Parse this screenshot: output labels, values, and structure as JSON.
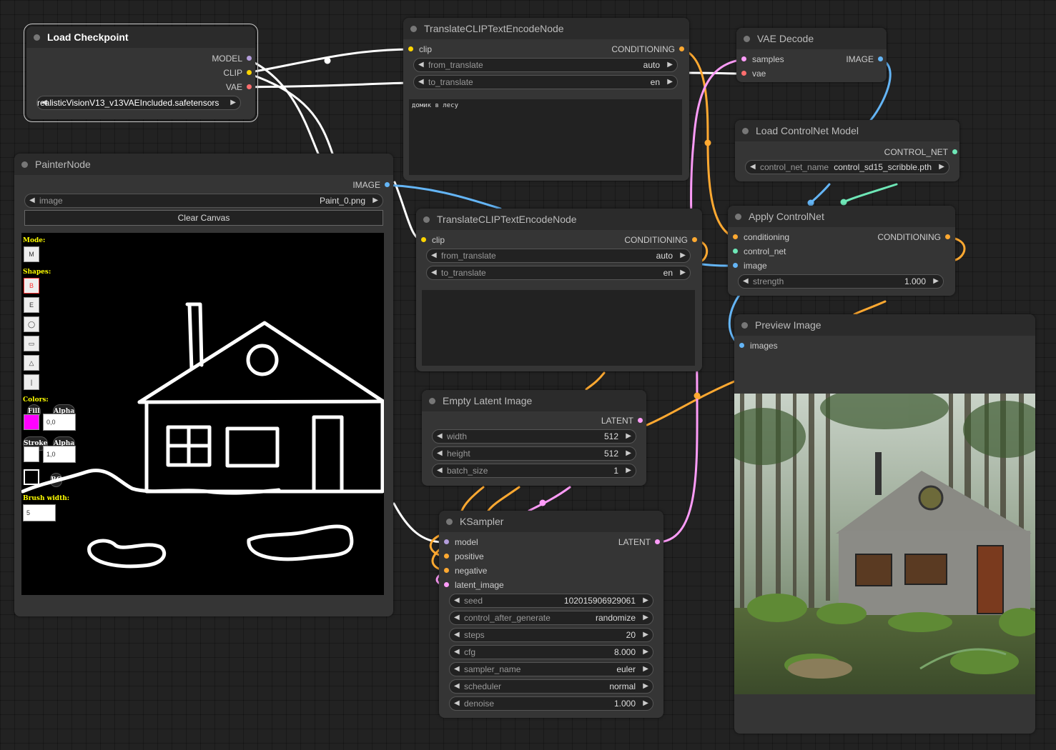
{
  "nodes": {
    "load_checkpoint": {
      "title": "Load Checkpoint",
      "outputs": [
        "MODEL",
        "CLIP",
        "VAE"
      ],
      "ckpt_name": "realisticVisionV13_v13VAEIncluded.safetensors"
    },
    "translate1": {
      "title": "TranslateCLIPTextEncodeNode",
      "input": "clip",
      "output": "CONDITIONING",
      "from_translate": {
        "name": "from_translate",
        "value": "auto"
      },
      "to_translate": {
        "name": "to_translate",
        "value": "en"
      },
      "text": "домик в лесу"
    },
    "translate2": {
      "title": "TranslateCLIPTextEncodeNode",
      "input": "clip",
      "output": "CONDITIONING",
      "from_translate": {
        "name": "from_translate",
        "value": "auto"
      },
      "to_translate": {
        "name": "to_translate",
        "value": "en"
      },
      "text": ""
    },
    "vae_decode": {
      "title": "VAE Decode",
      "inputs": [
        "samples",
        "vae"
      ],
      "output": "IMAGE"
    },
    "load_controlnet": {
      "title": "Load ControlNet Model",
      "output": "CONTROL_NET",
      "control_net_name": {
        "name": "control_net_name",
        "value": "control_sd15_scribble.pth"
      }
    },
    "apply_controlnet": {
      "title": "Apply ControlNet",
      "inputs": [
        "conditioning",
        "control_net",
        "image"
      ],
      "output": "CONDITIONING",
      "strength": {
        "name": "strength",
        "value": "1.000"
      }
    },
    "painter": {
      "title": "PainterNode",
      "output": "IMAGE",
      "image": {
        "name": "image",
        "value": "Paint_0.png"
      },
      "clear_button": "Clear Canvas",
      "toolbar": {
        "mode_label": "Mode:",
        "mode_btn": "M",
        "shapes_label": "Shapes:",
        "shape_buttons": [
          "B",
          "E",
          "◯",
          "▭",
          "△",
          "|"
        ],
        "colors_label": "Colors:",
        "fill_label": "Fill",
        "alpha_label": "Alpha",
        "fill_color": "#ff00ff",
        "fill_alpha": "0,0",
        "stroke_label": "Stroke",
        "stroke_color": "#ffffff",
        "stroke_alpha": "1,0",
        "bg_label": "BG",
        "brush_label": "Brush width:",
        "brush_width": "5"
      }
    },
    "empty_latent": {
      "title": "Empty Latent Image",
      "output": "LATENT",
      "widgets": [
        {
          "name": "width",
          "value": "512"
        },
        {
          "name": "height",
          "value": "512"
        },
        {
          "name": "batch_size",
          "value": "1"
        }
      ]
    },
    "ksampler": {
      "title": "KSampler",
      "inputs": [
        "model",
        "positive",
        "negative",
        "latent_image"
      ],
      "output": "LATENT",
      "widgets": [
        {
          "name": "seed",
          "value": "102015906929061"
        },
        {
          "name": "control_after_generate",
          "value": "randomize"
        },
        {
          "name": "steps",
          "value": "20"
        },
        {
          "name": "cfg",
          "value": "8.000"
        },
        {
          "name": "sampler_name",
          "value": "euler"
        },
        {
          "name": "scheduler",
          "value": "normal"
        },
        {
          "name": "denoise",
          "value": "1.000"
        }
      ]
    },
    "preview": {
      "title": "Preview Image",
      "input": "images"
    }
  },
  "colors": {
    "model": "#b39ddb",
    "clip": "#ffd500",
    "vae": "#ff6e6e",
    "conditioning": "#ffa931",
    "image": "#64b5f6",
    "latent": "#ff9cf9",
    "control_net": "#6ee7b7"
  },
  "icons": {
    "left_arrow": "left-triangle-icon",
    "right_arrow": "right-triangle-icon"
  }
}
